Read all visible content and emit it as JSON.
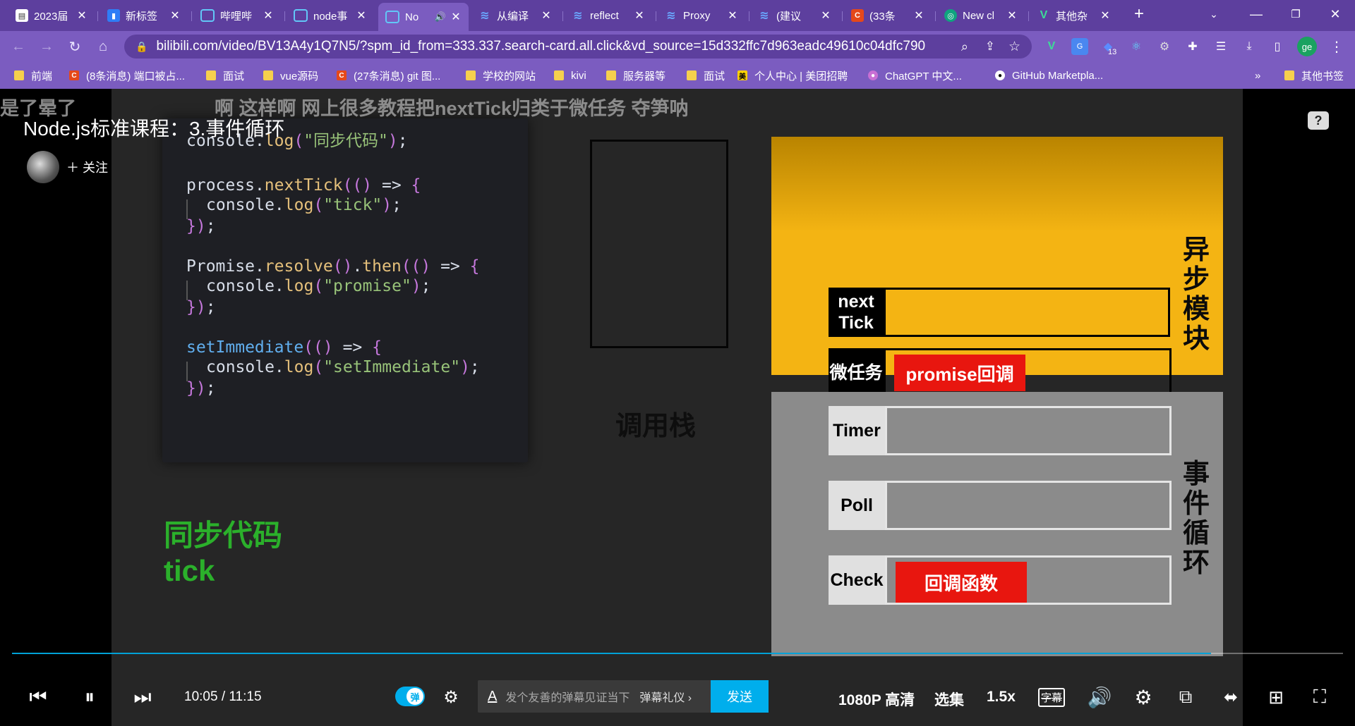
{
  "tabs": [
    {
      "title": "2023届",
      "color": "#ffffff",
      "fav": "📰"
    },
    {
      "title": "新标签",
      "color": "#ffffff",
      "fav": "🔖"
    },
    {
      "title": "哔哩哔",
      "color": "#fb7299",
      "fav": "B"
    },
    {
      "title": "node事",
      "color": "#fb7299",
      "fav": "B"
    },
    {
      "title": "No",
      "color": "#fb7299",
      "fav": "B",
      "active": true
    },
    {
      "title": "从编译",
      "color": "#3b82f6",
      "fav": "≈"
    },
    {
      "title": "reflect",
      "color": "#3b82f6",
      "fav": "≈"
    },
    {
      "title": "Proxy",
      "color": "#3b82f6",
      "fav": "≈"
    },
    {
      "title": "(建议",
      "color": "#3b82f6",
      "fav": "≈"
    },
    {
      "title": "(33条",
      "color": "#e5481a",
      "fav": "C"
    },
    {
      "title": "New cl",
      "color": "#10a37f",
      "fav": "◎"
    },
    {
      "title": "其他杂",
      "color": "#2bb673",
      "fav": "V"
    }
  ],
  "url": "bilibili.com/video/BV13A4y1Q7N5/?spm_id_from=333.337.search-card.all.click&vd_source=15d332ffc7d963eadc49610c04dfc790",
  "extension_badge": "13",
  "profile_initials": "ge",
  "bookmarks": [
    {
      "label": "前端",
      "type": "folder"
    },
    {
      "label": "(8条消息) 端口被占...",
      "type": "csdn"
    },
    {
      "label": "面试",
      "type": "folder"
    },
    {
      "label": "vue源码",
      "type": "folder"
    },
    {
      "label": "(27条消息) git 图...",
      "type": "csdn"
    },
    {
      "label": "学校的网站",
      "type": "folder"
    },
    {
      "label": "kivi",
      "type": "folder"
    },
    {
      "label": "服务器等",
      "type": "folder"
    },
    {
      "label": "面试",
      "type": "folder"
    },
    {
      "label": "个人中心 | 美团招聘",
      "type": "meituan"
    },
    {
      "label": "ChatGPT 中文...",
      "type": "chatgpt"
    },
    {
      "label": "GitHub Marketpla...",
      "type": "github"
    }
  ],
  "bookmarks_other": "其他书签",
  "bookmarks_more": "»",
  "video": {
    "title": "Node.js标准课程：3.事件循环",
    "follow_label": "关注",
    "danmaku": [
      "是了晕了",
      "啊 这样啊 网上很多教程把nextTick归类于微任务 夺笋呐"
    ]
  },
  "slide": {
    "code_lines": [
      {
        "id": "l1",
        "text": "console.log(\"同步代码\");"
      },
      {
        "id": "l2",
        "text": "process.nextTick(() => {"
      },
      {
        "id": "l3",
        "text": "  console.log(\"tick\");"
      },
      {
        "id": "l4",
        "text": "});"
      },
      {
        "id": "l5",
        "text": "Promise.resolve().then(() => {"
      },
      {
        "id": "l6",
        "text": "  console.log(\"promise\");"
      },
      {
        "id": "l7",
        "text": "});"
      },
      {
        "id": "l8",
        "text": "setImmediate(() => {"
      },
      {
        "id": "l9",
        "text": "  console.log(\"setImmediate\");"
      },
      {
        "id": "l10",
        "text": "});"
      }
    ],
    "sync_output": [
      "同步代码",
      "tick"
    ],
    "call_stack_label": "调用栈",
    "async_module": {
      "label": "异步模块",
      "next_tick": "next Tick",
      "microtask": "微任务",
      "microtask_item": "promise回调"
    },
    "event_loop": {
      "label": "事件循环",
      "timer": "Timer",
      "poll": "Poll",
      "check": "Check",
      "check_item": "回调函数"
    }
  },
  "player": {
    "current_time": "10:05",
    "duration": "11:15",
    "progress_percent": 90.1,
    "danmaku_toggle": "弹",
    "danmaku_placeholder": "发个友善的弹幕见证当下",
    "danmaku_etiquette": "弹幕礼仪 ›",
    "send": "发送",
    "quality": "1080P 高清",
    "episodes": "选集",
    "speed": "1.5x",
    "subtitle": "字幕"
  },
  "colors": {
    "tabbar": "#5d3f9e",
    "toolbar": "#7b5cc0",
    "bilibili_blue": "#00aeec",
    "async_yellow": "#f4b413",
    "red_tag": "#e8160f",
    "sync_green": "#2bb02b"
  }
}
